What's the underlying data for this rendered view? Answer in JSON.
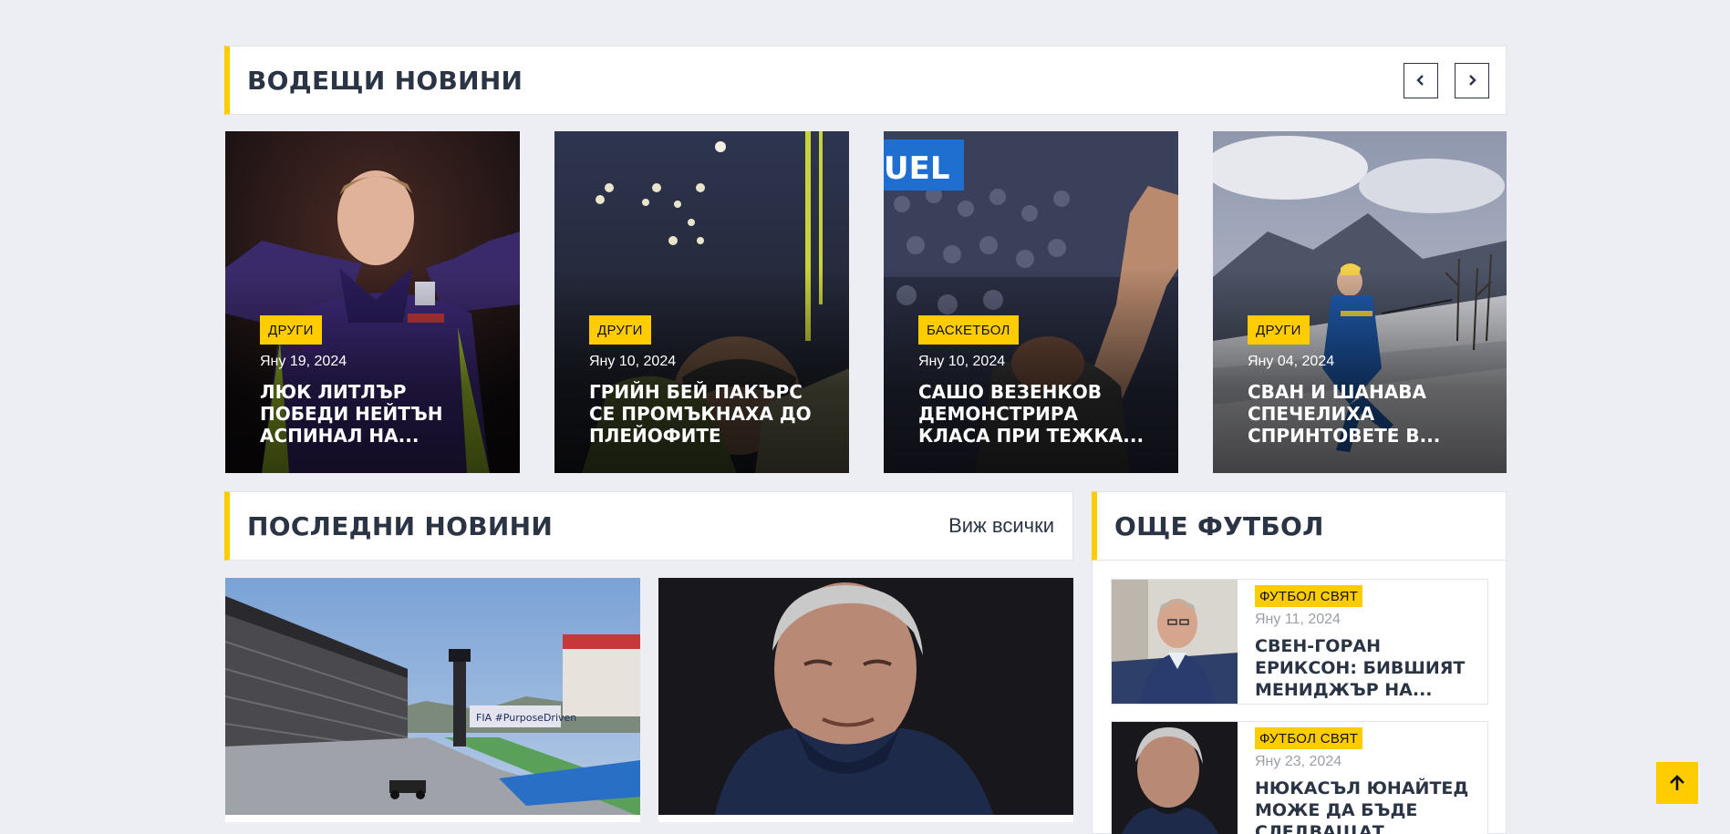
{
  "lead": {
    "title": "ВОДЕЩИ НОВИНИ",
    "cards": [
      {
        "category": "ДРУГИ",
        "date": "Яну 19, 2024",
        "title": "ЛЮК ЛИТЛЪР ПОБЕДИ НЕЙТЪН АСПИНАЛ НА..."
      },
      {
        "category": "ДРУГИ",
        "date": "Яну 10, 2024",
        "title": "ГРИЙН БЕЙ ПАКЪРС СЕ ПРОМЪКНАХА ДО ПЛЕЙОФИТЕ"
      },
      {
        "category": "БАСКЕТБОЛ",
        "date": "Яну 10, 2024",
        "title": "САШО ВЕЗЕНКОВ ДЕМОНСТРИРА КЛАСА ПРИ ТЕЖКА..."
      },
      {
        "category": "ДРУГИ",
        "date": "Яну 04, 2024",
        "title": "СВАН И ШАНАВА СПЕЧЕЛИХА СПРИНТОВЕТЕ В..."
      }
    ]
  },
  "latest": {
    "title": "ПОСЛЕДНИ НОВИНИ",
    "view_all": "Виж всички"
  },
  "more_football": {
    "title": "ОЩЕ ФУТБОЛ",
    "items": [
      {
        "category": "ФУТБОЛ СВЯТ",
        "date": "Яну 11, 2024",
        "title": "СВЕН-ГОРАН ЕРИКСОН: БИВШИЯТ МЕНИДЖЪР НА..."
      },
      {
        "category": "ФУТБОЛ СВЯТ",
        "date": "Яну 23, 2024",
        "title": "НЮКАСЪЛ ЮНАЙТЕД МОЖЕ ДА БЪДЕ СЛЕДВАЩАТ..."
      }
    ]
  },
  "colors": {
    "accent": "#ffcc00",
    "heading": "#2b3445",
    "background": "#eceef4"
  },
  "icons": {
    "prev": "chevron-left-icon",
    "next": "chevron-right-icon",
    "to_top": "arrow-up-icon"
  }
}
